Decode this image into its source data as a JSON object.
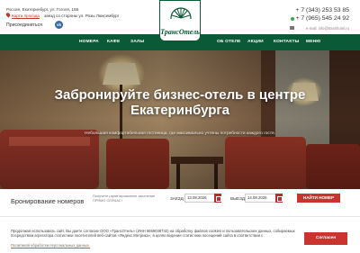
{
  "header": {
    "address": "Россия, Екатеринбург, ул. Гоголя, 15Б",
    "map_link": "Карта проезда",
    "arrival_info": "заезд со стороны ул. Розы Люксембург",
    "join_label": "Присоединиться",
    "vk_icon": "vk-icon",
    "logo_text": "ТрансОтель",
    "phone_1": "+ 7 (343) 253 53 85",
    "phone_2": "+ 7 (965) 545 24 92",
    "email": "e-mail: info@transhotel.ru"
  },
  "nav": {
    "items": [
      "НОМЕРА",
      "КАФЕ",
      "ЗАЛЫ",
      "ОБ ОТЕЛЕ",
      "АКЦИИ",
      "КОНТАКТЫ",
      "МЕНЮ"
    ]
  },
  "hero": {
    "title_line1": "Забронируйте бизнес-отель в центре",
    "title_line2": "Екатеринбурга",
    "subtitle": "Небольшая комфортабельная гостиница, где максимально учтены потребности каждого гостя."
  },
  "booking": {
    "title": "Бронирование номеров",
    "note": "Получите гарантированное заселение ПРЯМО СЕЙЧАС!",
    "checkin_label": "ЗАЕЗД",
    "checkin_value": "13.08.2026",
    "checkout_label": "ВЫЕЗД",
    "checkout_value": "14.08.2026",
    "find_button": "НАЙТИ НОМЕР"
  },
  "cookie": {
    "text": "Продолжая использовать сайт, Вы даете согласие ООО «ТрансОтель» (ИНН 6659038732) на обработку файлов cookies и пользовательских данных, собираемых посредством агрегатора статистики посетителей веб-сайтов «Яндекс.Метрика», в целях ведения статистики посещений сайта в соответствии с",
    "link": "Политикой обработки персональных данных.",
    "agree_button": "Согласен"
  },
  "colors": {
    "brand_green": "#0b5a37",
    "accent_red": "#c9342e"
  }
}
